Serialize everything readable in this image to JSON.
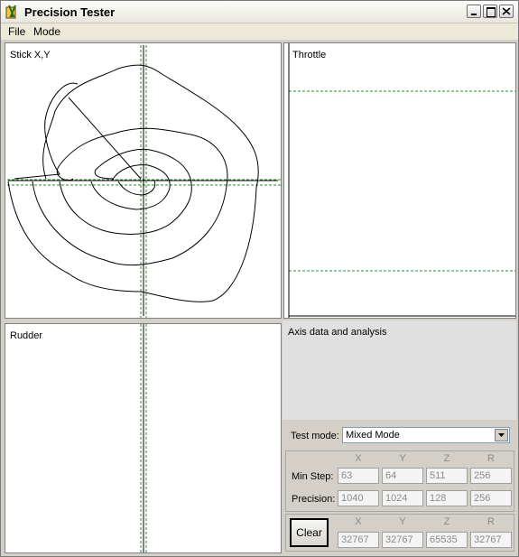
{
  "window": {
    "title": "Precision Tester"
  },
  "menu": {
    "items": [
      "File",
      "Mode"
    ]
  },
  "panels": {
    "stick": {
      "label": "Stick X,Y"
    },
    "throttle": {
      "label": "Throttle"
    },
    "rudder": {
      "label": "Rudder"
    },
    "analysis": {
      "label": "Axis data and analysis"
    }
  },
  "test_mode": {
    "label": "Test mode:",
    "value": "Mixed Mode"
  },
  "axis_headers": [
    "X",
    "Y",
    "Z",
    "R"
  ],
  "min_step": {
    "label": "Min Step:",
    "values": [
      "63",
      "64",
      "511",
      "256"
    ]
  },
  "precision": {
    "label": "Precision:",
    "values": [
      "1040",
      "1024",
      "128",
      "256"
    ]
  },
  "clear": {
    "button": "Clear",
    "values": [
      "32767",
      "32767",
      "65535",
      "32767"
    ]
  },
  "colors": {
    "guide_line": "#2e8b2e",
    "trace": "#000000"
  }
}
